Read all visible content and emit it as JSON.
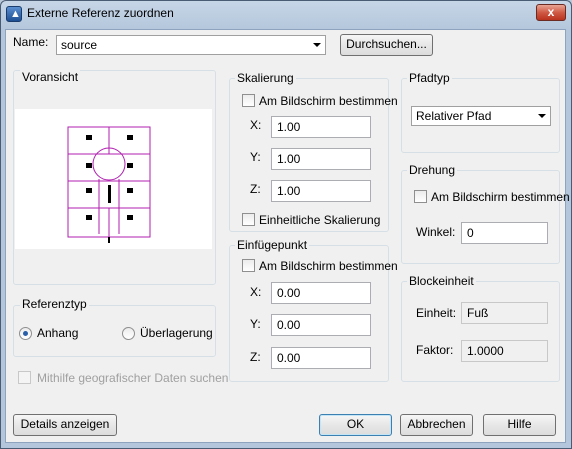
{
  "window": {
    "title": "Externe Referenz zuordnen",
    "close_glyph": "x"
  },
  "name_row": {
    "label": "Name:",
    "value": "source",
    "browse_button": "Durchsuchen..."
  },
  "preview": {
    "title": "Voransicht"
  },
  "scale": {
    "title": "Skalierung",
    "on_screen": "Am Bildschirm bestimmen",
    "x_label": "X:",
    "x_value": "1.00",
    "y_label": "Y:",
    "y_value": "1.00",
    "z_label": "Z:",
    "z_value": "1.00",
    "uniform": "Einheitliche Skalierung"
  },
  "insert": {
    "title": "Einfügepunkt",
    "on_screen": "Am Bildschirm bestimmen",
    "x_label": "X:",
    "x_value": "0.00",
    "y_label": "Y:",
    "y_value": "0.00",
    "z_label": "Z:",
    "z_value": "0.00"
  },
  "path_type": {
    "title": "Pfadtyp",
    "selected": "Relativer Pfad"
  },
  "rotation": {
    "title": "Drehung",
    "on_screen": "Am Bildschirm bestimmen",
    "angle_label": "Winkel:",
    "angle_value": "0"
  },
  "block_unit": {
    "title": "Blockeinheit",
    "unit_label": "Einheit:",
    "unit_value": "Fuß",
    "factor_label": "Faktor:",
    "factor_value": "1.0000"
  },
  "ref_type": {
    "title": "Referenztyp",
    "attach": "Anhang",
    "overlay": "Überlagerung",
    "selected": "attach"
  },
  "geo": {
    "label": "Mithilfe geografischer Daten suchen"
  },
  "buttons": {
    "details": "Details anzeigen",
    "ok": "OK",
    "cancel": "Abbrechen",
    "help": "Hilfe"
  },
  "colors": {
    "preview_lines": "#b01fb0",
    "accent": "#2a5fa8"
  }
}
